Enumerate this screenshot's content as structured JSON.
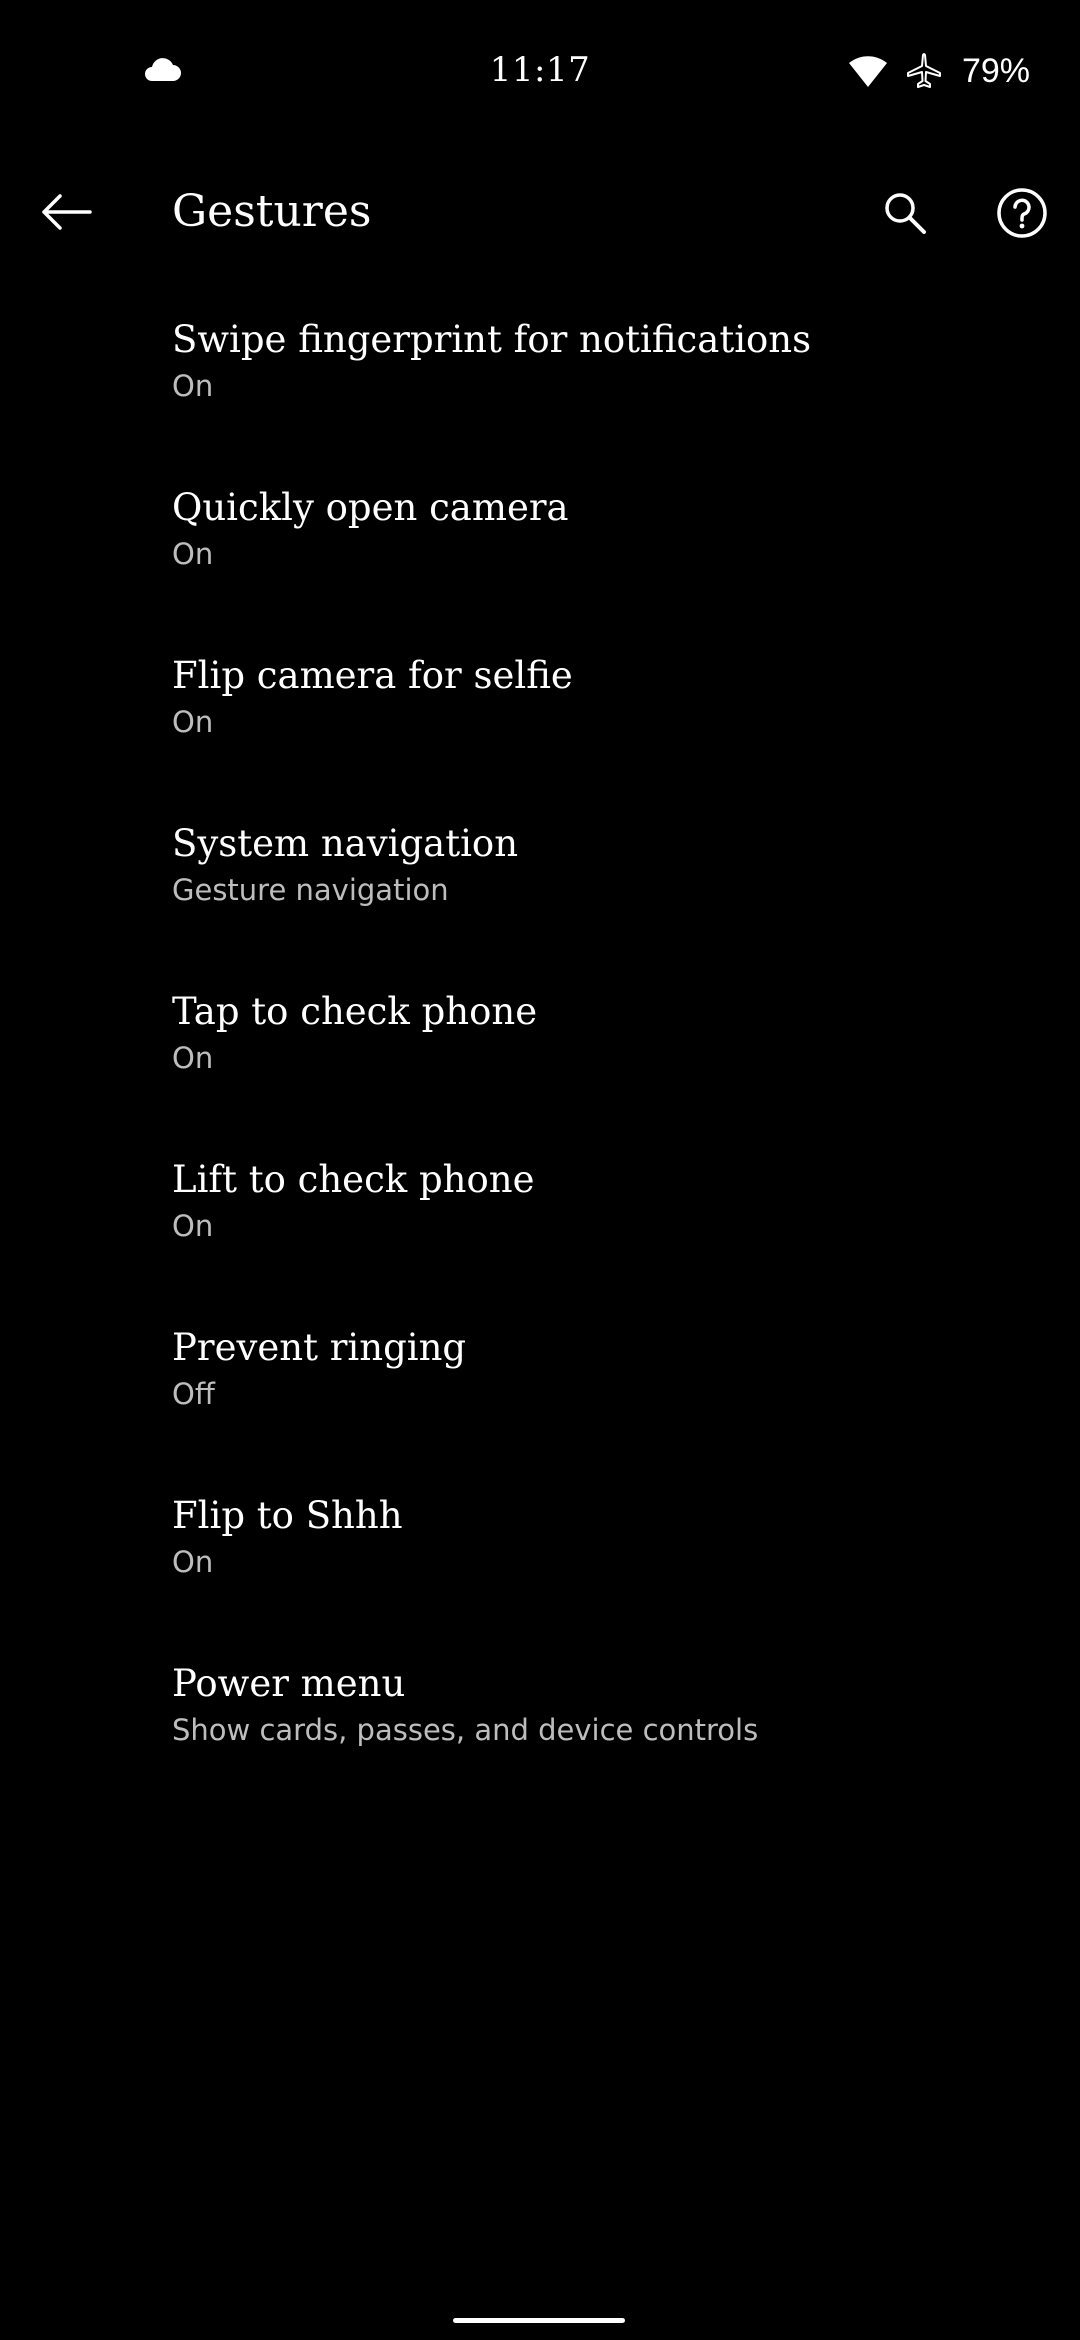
{
  "status_bar": {
    "time": "11:17",
    "battery": "79%",
    "icons": [
      "cloud-icon",
      "wifi-icon",
      "airplane-icon"
    ]
  },
  "app_bar": {
    "title": "Gestures",
    "back_icon": "back-arrow-icon",
    "search_icon": "search-icon",
    "help_icon": "help-icon"
  },
  "settings": [
    {
      "title": "Swipe fingerprint for notifications",
      "summary": "On"
    },
    {
      "title": "Quickly open camera",
      "summary": "On"
    },
    {
      "title": "Flip camera for selfie",
      "summary": "On"
    },
    {
      "title": "System navigation",
      "summary": "Gesture navigation"
    },
    {
      "title": "Tap to check phone",
      "summary": "On"
    },
    {
      "title": "Lift to check phone",
      "summary": "On"
    },
    {
      "title": "Prevent ringing",
      "summary": "Off"
    },
    {
      "title": "Flip to Shhh",
      "summary": "On"
    },
    {
      "title": "Power menu",
      "summary": "Show cards, passes, and device controls"
    }
  ],
  "colors": {
    "background": "#000000",
    "text_primary": "#ffffff",
    "text_secondary": "#bdbdbd"
  }
}
